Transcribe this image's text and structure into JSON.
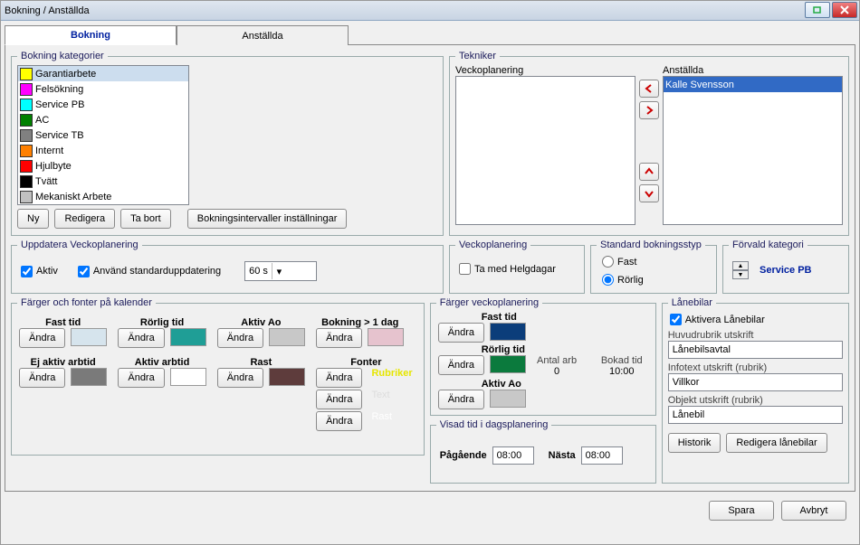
{
  "window_title": "Bokning / Anställda",
  "tabs": {
    "booking": "Bokning",
    "employees": "Anställda"
  },
  "categories": {
    "legend": "Bokning kategorier",
    "items": [
      {
        "label": "Garantiarbete",
        "color": "#ffff00"
      },
      {
        "label": "Felsökning",
        "color": "#ff00ff"
      },
      {
        "label": "Service PB",
        "color": "#00ffff"
      },
      {
        "label": "AC",
        "color": "#008000"
      },
      {
        "label": "Service TB",
        "color": "#808080"
      },
      {
        "label": "Internt",
        "color": "#ff8000"
      },
      {
        "label": "Hjulbyte",
        "color": "#ff0000"
      },
      {
        "label": "Tvätt",
        "color": "#000000"
      },
      {
        "label": "Mekaniskt Arbete",
        "color": "#c0c0c0"
      }
    ],
    "btn_new": "Ny",
    "btn_edit": "Redigera",
    "btn_delete": "Ta bort",
    "btn_interval": "Bokningsintervaller inställningar"
  },
  "weekupdate": {
    "legend": "Uppdatera Veckoplanering",
    "active": "Aktiv",
    "use_default": "Använd standarduppdatering",
    "interval": "60 s"
  },
  "tekniker": {
    "legend": "Tekniker",
    "left_label": "Veckoplanering",
    "right_label": "Anställda",
    "employee_selected": "Kalle Svensson"
  },
  "veckoplanering": {
    "legend": "Veckoplanering",
    "include_holidays": "Ta med Helgdagar"
  },
  "booking_type": {
    "legend": "Standard bokningsstyp",
    "fast": "Fast",
    "rorlig": "Rörlig"
  },
  "preselected": {
    "legend": "Förvald kategori",
    "value": "Service PB"
  },
  "cal_colors": {
    "legend": "Färger och fonter på kalender",
    "fast": "Fast tid",
    "rorlig": "Rörlig tid",
    "aktiv_ao": "Aktiv Ao",
    "booking_gt": "Bokning > 1 dag",
    "ej_aktiv": "Ej aktiv arbtid",
    "aktiv_arb": "Aktiv arbtid",
    "rast": "Rast",
    "fonts": "Fonter",
    "font_rubriker": "Rubriker",
    "font_text": "Text",
    "font_rast": "Rast",
    "btn_change": "Ändra"
  },
  "week_colors": {
    "legend": "Färger veckoplanering",
    "fast": "Fast tid",
    "rorlig": "Rörlig tid",
    "aktiv_ao": "Aktiv Ao",
    "antal_arb_lbl": "Antal arb",
    "antal_arb_val": "0",
    "bokad_lbl": "Bokad tid",
    "bokad_val": "10:00"
  },
  "visad_tid": {
    "legend": "Visad tid i dagsplanering",
    "ongoing_lbl": "Pågående",
    "ongoing_val": "08:00",
    "next_lbl": "Nästa",
    "next_val": "08:00"
  },
  "lanebilar": {
    "legend": "Lånebilar",
    "activate": "Aktivera Lånebilar",
    "main_heading_lbl": "Huvudrubrik utskrift",
    "main_heading_val": "Lånebilsavtal",
    "infotext_lbl": "Infotext utskrift (rubrik)",
    "infotext_val": "Villkor",
    "object_lbl": "Objekt utskrift (rubrik)",
    "object_val": "Lånebil",
    "btn_history": "Historik",
    "btn_edit": "Redigera lånebilar"
  },
  "footer": {
    "save": "Spara",
    "cancel": "Avbryt"
  }
}
